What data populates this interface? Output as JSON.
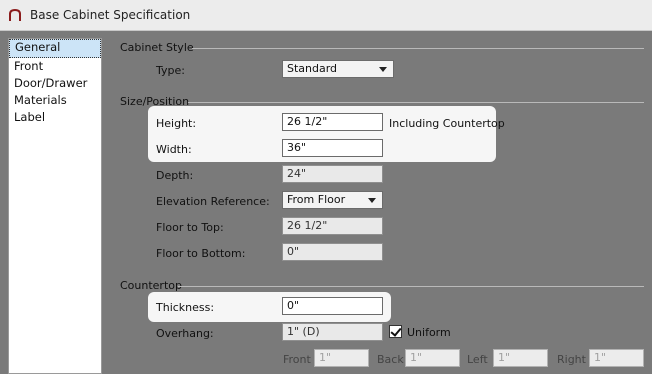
{
  "window": {
    "title": "Base Cabinet Specification"
  },
  "nav": {
    "items": [
      "General",
      "Front",
      "Door/Drawer",
      "Materials",
      "Label"
    ],
    "selected_index": 0
  },
  "cabinet_style": {
    "section_title": "Cabinet Style",
    "type_label": "Type:",
    "type_value": "Standard"
  },
  "size_position": {
    "section_title": "Size/Position",
    "height_label": "Height:",
    "height_value": "26 1/2\"",
    "height_note": "Including Countertop",
    "width_label": "Width:",
    "width_value": "36\"",
    "depth_label": "Depth:",
    "depth_value": "24\"",
    "elevation_label": "Elevation Reference:",
    "elevation_value": "From Floor",
    "floor_to_top_label": "Floor to Top:",
    "floor_to_top_value": "26 1/2\"",
    "floor_to_bottom_label": "Floor to Bottom:",
    "floor_to_bottom_value": "0\""
  },
  "countertop": {
    "section_title": "Countertop",
    "thickness_label": "Thickness:",
    "thickness_value": "0\"",
    "overhang_label": "Overhang:",
    "overhang_value": "1\" (D)",
    "uniform_label": "Uniform",
    "uniform_checked": true,
    "front_label": "Front",
    "front_value": "1\"",
    "back_label": "Back",
    "back_value": "1\"",
    "left_label": "Left",
    "left_value": "1\"",
    "right_label": "Right",
    "right_value": "1\""
  },
  "colors": {
    "selection": "#cce4f7",
    "background": "#7a7a7a",
    "highlight": "#f6f6f6"
  }
}
